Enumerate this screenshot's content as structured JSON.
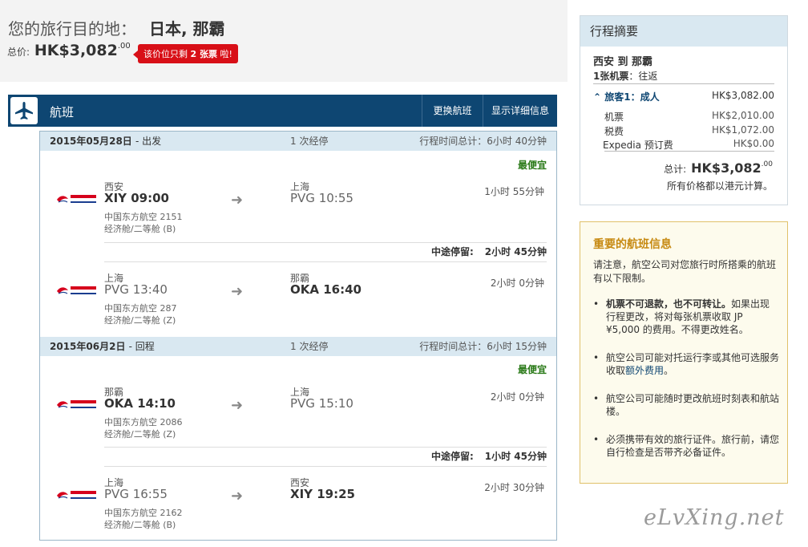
{
  "header": {
    "dest_label": "您的旅行目的地：",
    "dest_value": "日本, 那霸",
    "total_label": "总价:",
    "total_main": "HK$3,082",
    "total_cents": ".00",
    "badge_pre": "该价位只剩",
    "badge_num": "2 张票",
    "badge_post": "啦!"
  },
  "flight_bar": {
    "title": "航班",
    "change_label": "更换航班",
    "details_label": "显示详细信息"
  },
  "legs": [
    {
      "date": "2015年05月28日",
      "dir": "- 出发",
      "stops": "1 次经停",
      "total_time": "行程时间总计：6小时 40分钟",
      "cheapest": "最便宜",
      "segments": [
        {
          "dep_city": "西安",
          "dep_code_time": "XIY 09:00",
          "airline": "中国东方航空 2151",
          "cabin": "经济舱/二等舱 (B)",
          "arr_city": "上海",
          "arr_code_time": "PVG 10:55",
          "duration": "1小时 55分钟"
        },
        {
          "dep_city": "上海",
          "dep_code_time": "PVG 13:40",
          "airline": "中国东方航空 287",
          "cabin": "经济舱/二等舱 (Z)",
          "arr_city": "那霸",
          "arr_code_time": "OKA 16:40",
          "duration": "2小时 0分钟"
        }
      ],
      "layover_label": "中途停留:",
      "layover_value": "2小时 45分钟"
    },
    {
      "date": "2015年06月2日",
      "dir": "- 回程",
      "stops": "1 次经停",
      "total_time": "行程时间总计：6小时 15分钟",
      "cheapest": "最便宜",
      "segments": [
        {
          "dep_city": "那霸",
          "dep_code_time": "OKA 14:10",
          "airline": "中国东方航空 2086",
          "cabin": "经济舱/二等舱 (Z)",
          "arr_city": "上海",
          "arr_code_time": "PVG 15:10",
          "duration": "2小时 0分钟"
        },
        {
          "dep_city": "上海",
          "dep_code_time": "PVG 16:55",
          "airline": "中国东方航空 2162",
          "cabin": "经济舱/二等舱 (B)",
          "arr_city": "西安",
          "arr_code_time": "XIY 19:25",
          "duration": "2小时 30分钟"
        }
      ],
      "layover_label": "中途停留:",
      "layover_value": "1小时 45分钟"
    }
  ],
  "airline_logo": {
    "cn": "中国东方航空",
    "en": "CHINA EASTERN",
    "color": "#d6001c"
  },
  "summary": {
    "title": "行程摘要",
    "route": "西安 到 那霸",
    "ticket_count": "1张机票",
    "ticket_type": "：往返",
    "traveler_label": "旅客1：成人",
    "traveler_value": "HK$3,082.00",
    "rows": [
      {
        "label": "机票",
        "value": "HK$2,010.00"
      },
      {
        "label": "税费",
        "value": "HK$1,072.00"
      },
      {
        "label": "Expedia 预订费",
        "value": "HK$0.00"
      }
    ],
    "total_label": "总计:",
    "total_main": "HK$3,082",
    "total_cents": ".00",
    "note": "所有价格都以港元计算。"
  },
  "info": {
    "title": "重要的航班信息",
    "intro": "请注意，航空公司对您旅行时所搭乘的航班有以下限制。",
    "item1_b": "机票不可退款，也不可转让。",
    "item1_rest": "如果出现行程更改，将对每张机票收取 JP ¥5,000 的费用。不得更改姓名。",
    "item2_pre": "航空公司可能对托运行李或其他可选服务收取",
    "item2_link": "额外费用",
    "item2_post": "。",
    "item3": "航空公司可能随时更改航班时刻表和航站楼。",
    "item4": "必须携带有效的旅行证件。旅行前，请您自行检查是否带齐必备证件。"
  },
  "watermark": "eLvXing.net"
}
